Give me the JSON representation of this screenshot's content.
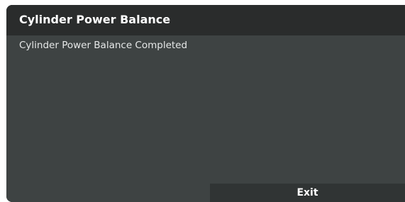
{
  "dialog": {
    "title": "Cylinder Power Balance",
    "message": "Cylinder Power Balance Completed",
    "exit_label": "Exit"
  }
}
